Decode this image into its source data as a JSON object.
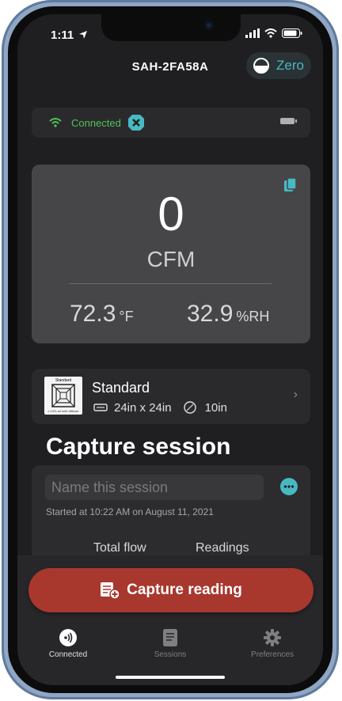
{
  "status": {
    "time": "1:11"
  },
  "header": {
    "device_title": "SAH-2FA58A",
    "zero_label": "Zero"
  },
  "connection": {
    "status_text": "Connected"
  },
  "reading": {
    "flow_value": "0",
    "flow_unit": "CFM",
    "temperature_value": "72.3",
    "temperature_unit": "°F",
    "humidity_value": "32.9",
    "humidity_unit": "%RH"
  },
  "hood": {
    "thumb_label": "Standard",
    "thumb_sub": "x 10% air inlet diffuser",
    "name": "Standard",
    "size": "24in x 24in",
    "diameter": "10in"
  },
  "session": {
    "heading": "Capture session",
    "name_placeholder": "Name this session",
    "started_text": "Started at 10:22 AM on August 11, 2021",
    "tabs": [
      "Total flow",
      "Readings"
    ]
  },
  "actions": {
    "capture_label": "Capture reading"
  },
  "tabbar": {
    "items": [
      {
        "label": "Connected",
        "icon": "connected-icon"
      },
      {
        "label": "Sessions",
        "icon": "document-icon"
      },
      {
        "label": "Preferences",
        "icon": "gear-icon"
      }
    ]
  },
  "colors": {
    "accent": "#47b9c2",
    "connected_green": "#4fc35a",
    "capture_red": "#a8372e",
    "background": "#1f1f21"
  }
}
